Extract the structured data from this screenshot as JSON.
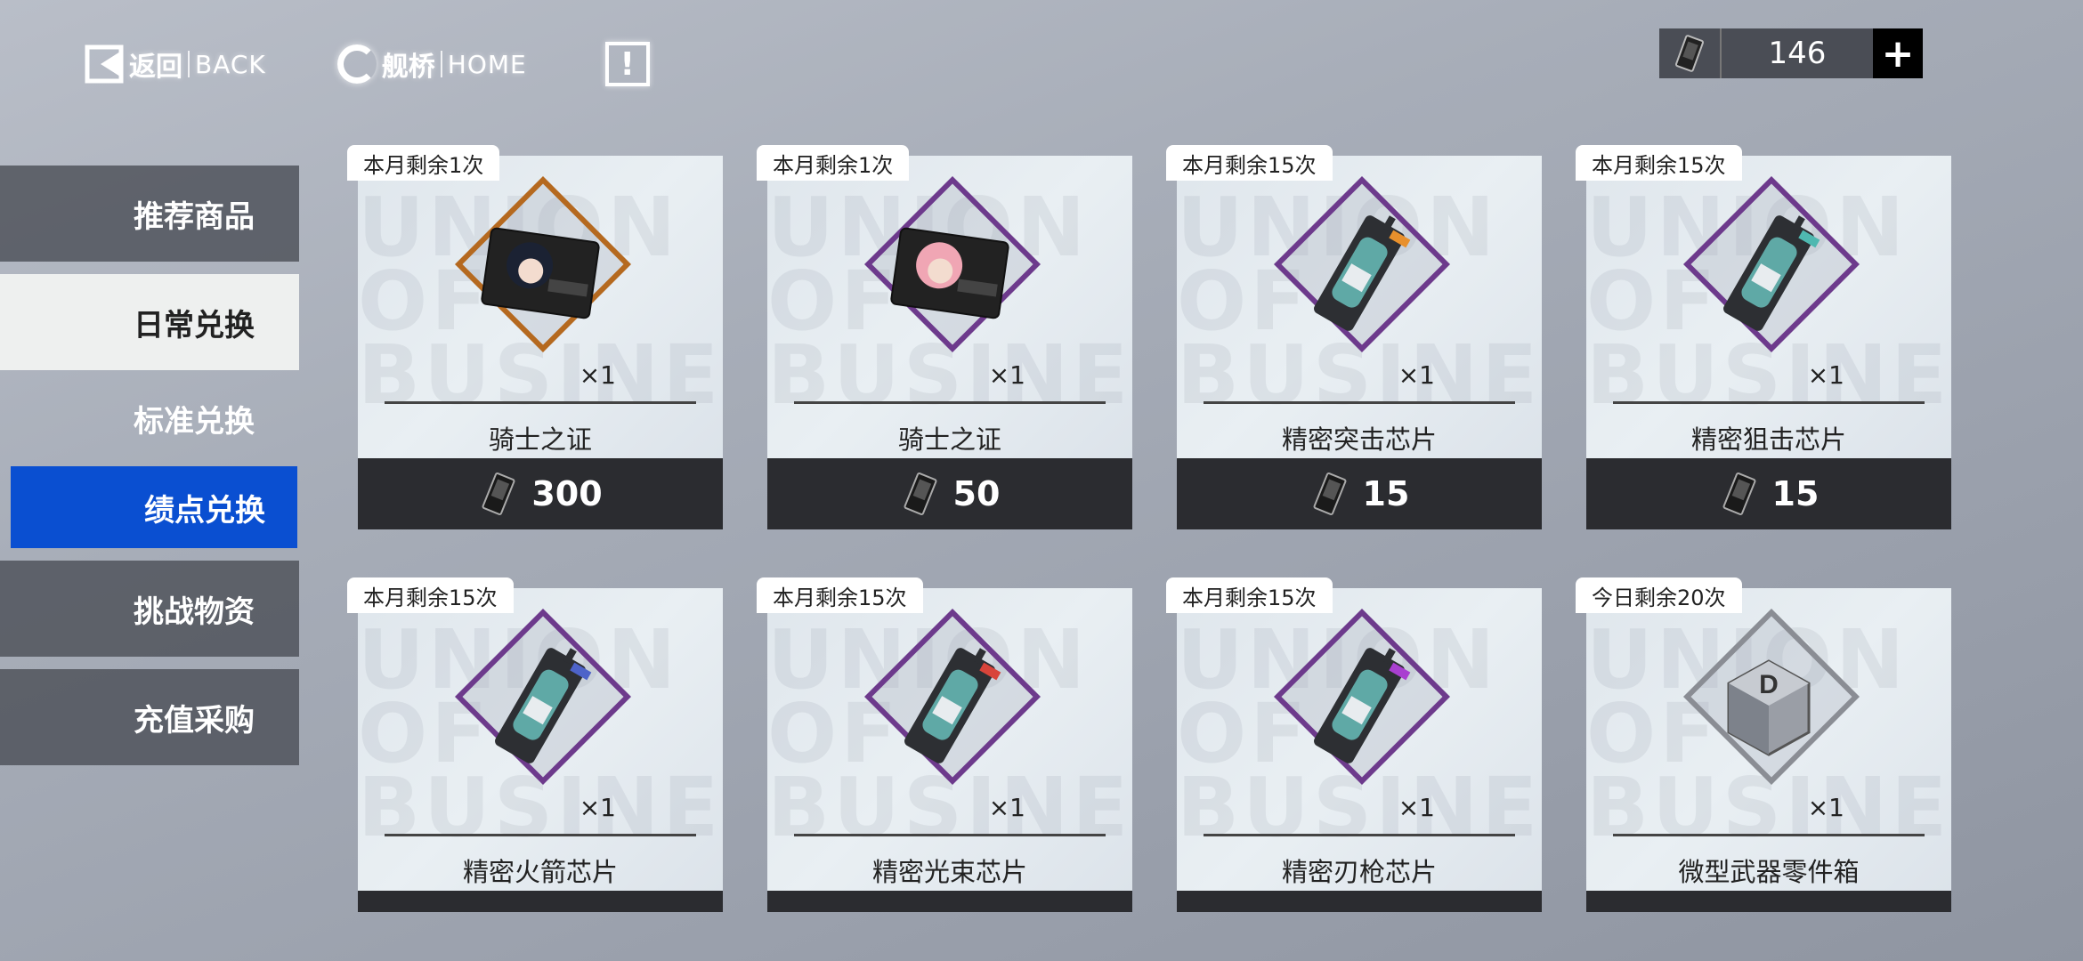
{
  "nav": {
    "back_cn": "返回",
    "back_en": "BACK",
    "home_cn": "舰桥",
    "home_en": "HOME",
    "info": "!"
  },
  "currency": {
    "amount": "146",
    "plus": "+"
  },
  "sidebar": {
    "items": [
      {
        "label": "推荐商品"
      },
      {
        "label": "日常兑换"
      },
      {
        "label": "标准兑换"
      },
      {
        "label": "绩点兑换"
      },
      {
        "label": "挑战物资"
      },
      {
        "label": "充值采购"
      }
    ]
  },
  "watermark": "UNION OF BUSINESS",
  "cards": [
    {
      "limit": "本月剩余1次",
      "qty": "×1",
      "name": "骑士之证",
      "price": "300"
    },
    {
      "limit": "本月剩余1次",
      "qty": "×1",
      "name": "骑士之证",
      "price": "50"
    },
    {
      "limit": "本月剩余15次",
      "qty": "×1",
      "name": "精密突击芯片",
      "price": "15"
    },
    {
      "limit": "本月剩余15次",
      "qty": "×1",
      "name": "精密狙击芯片",
      "price": "15"
    },
    {
      "limit": "本月剩余15次",
      "qty": "×1",
      "name": "精密火箭芯片",
      "price": ""
    },
    {
      "limit": "本月剩余15次",
      "qty": "×1",
      "name": "精密光束芯片",
      "price": ""
    },
    {
      "limit": "本月剩余15次",
      "qty": "×1",
      "name": "精密刃枪芯片",
      "price": ""
    },
    {
      "limit": "今日剩余20次",
      "qty": "×1",
      "name": "微型武器零件箱",
      "price": ""
    }
  ],
  "colors": {
    "active_tab": "#0a4fd1",
    "frame_purple": "#6d3a8c",
    "frame_orange": "#b5691f",
    "price_bar": "#2b2c30",
    "chip_tags": [
      "#e8902c",
      "#4fb8b0",
      "#4d63c9",
      "#d8443a",
      "#a93fd0"
    ]
  },
  "icons": [
    "back-icon",
    "home-icon",
    "info-icon",
    "currency-icon",
    "plus-icon",
    "item-icon"
  ]
}
